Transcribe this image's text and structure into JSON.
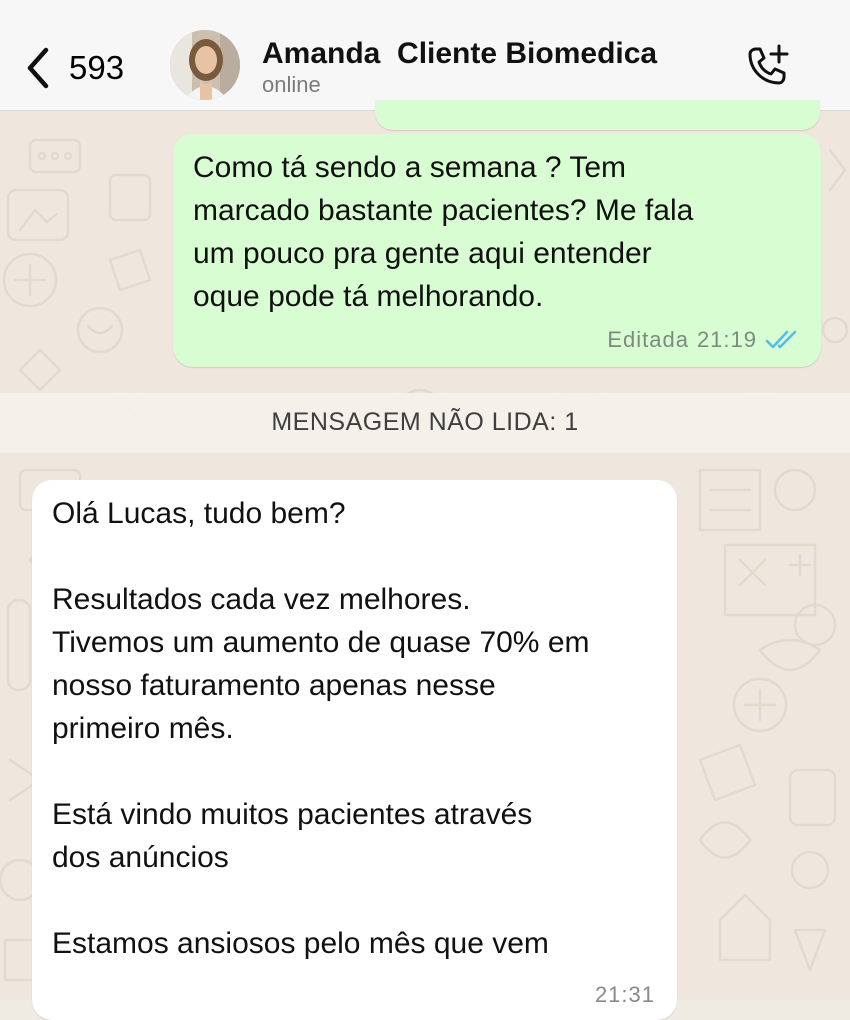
{
  "header": {
    "back_count": "593",
    "contact_name": "Amanda  Cliente Biomedica",
    "status": "online",
    "icons": {
      "back": "chevron-left-icon",
      "call": "add-call-icon",
      "avatar": "contact-avatar"
    }
  },
  "messages": {
    "outgoing": {
      "text": "Como tá sendo a semana ? Tem\nmarcado bastante pacientes? Me fala\num pouco pra gente aqui entender\noque pode tá melhorando.",
      "edited_label": "Editada",
      "time": "21:19",
      "status_icon": "double-check-read-icon",
      "status_color": "#53bdeb"
    },
    "unread_divider": "MENSAGEM NÃO LIDA: 1",
    "incoming": {
      "text": "Olá Lucas, tudo bem?\n\nResultados cada vez melhores.\nTivemos um aumento de quase 70% em\nnosso faturamento apenas nesse\nprimeiro mês.\n\nEstá vindo muitos pacientes através\ndos anúncios\n\nEstamos ansiosos pelo mês que vem",
      "time": "21:31"
    }
  },
  "colors": {
    "outgoing_bubble": "#d9fdd3",
    "incoming_bubble": "#ffffff",
    "chat_background": "#efe7de",
    "header_background": "#f7f7f7"
  }
}
